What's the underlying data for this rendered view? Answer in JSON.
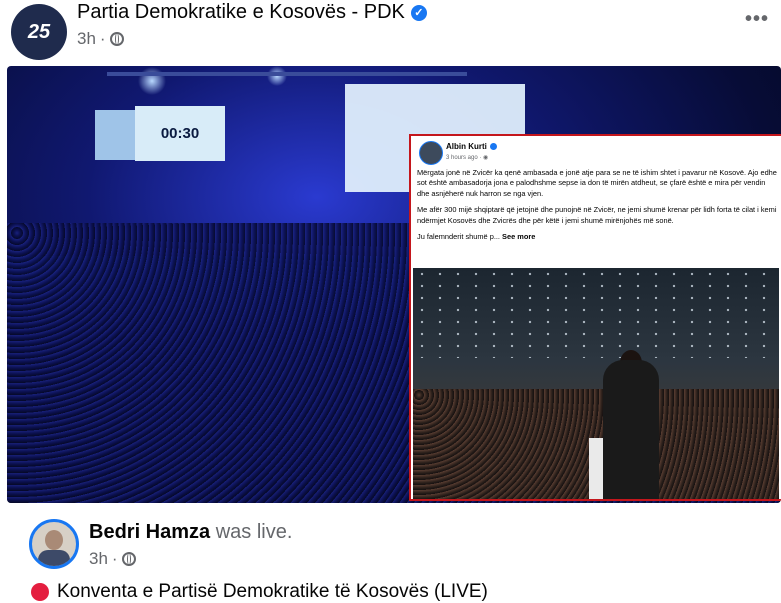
{
  "post": {
    "page_name": "Partia Demokratike e Kosovës - PDK",
    "avatar_text": "25",
    "time": "3h",
    "separator": "·",
    "more_label": "•••"
  },
  "stage": {
    "clock": "00:30"
  },
  "inset_post": {
    "author": "Albin Kurti",
    "time": "3 hours ago",
    "separator": "·",
    "paragraph1": "Mërgata jonë në Zvicër ka qenë ambasada e jonë atje para se ne të ishim shtet i pavarur në Kosovë. Ajo edhe sot është ambasadorja jona e palodhshme sepse ia don të mirën atdheut, se çfarë është e mira për vendin dhe asnjëherë nuk harron se nga vjen.",
    "paragraph2": "Me afër 300 mijë shqiptarë që jetojnë dhe punojnë në Zvicër, ne jemi shumë krenar për lidh forta të cilat i kemi ndërmjet Kosovës dhe Zvicrës dhe për këtë i jemi shumë mirënjohës më sonë.",
    "paragraph3": "Ju falemnderit shumë p...",
    "see_more": "See more"
  },
  "shared": {
    "author": "Bedri Hamza",
    "action": "was live.",
    "time": "3h",
    "separator": "·",
    "live_title": "Konventa e Partisë Demokratike të Kosovës (LIVE)"
  },
  "colors": {
    "accent": "#1877f2",
    "live": "#e41e3f",
    "highlight_border": "#c4161c"
  }
}
